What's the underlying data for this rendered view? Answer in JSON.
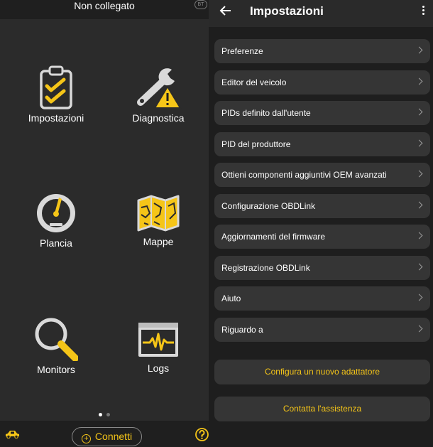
{
  "colors": {
    "accent": "#f5c518",
    "left_bg": "#2b2b2b",
    "right_bg": "#1e1e1e",
    "item_bg": "#353535"
  },
  "left": {
    "status": "Non collegato",
    "bt_badge": "BT",
    "tiles": [
      {
        "label": "Impostazioni",
        "icon": "clipboard-checklist-icon"
      },
      {
        "label": "Diagnostica",
        "icon": "wrench-warning-icon"
      },
      {
        "label": "Plancia",
        "icon": "gauge-icon"
      },
      {
        "label": "Mappe",
        "icon": "map-icon"
      },
      {
        "label": "Monitors",
        "icon": "magnifier-icon"
      },
      {
        "label": "Logs",
        "icon": "waveform-log-icon"
      }
    ],
    "page_indicator": {
      "pages": 2,
      "active": 1
    },
    "bottom": {
      "car_icon": "car-icon",
      "connect_label": "Connetti",
      "help_icon": "help-icon"
    }
  },
  "right": {
    "title": "Impostazioni",
    "back_icon": "arrow-left-icon",
    "menu_icon": "kebab-menu-icon",
    "items": [
      {
        "label": "Preferenze"
      },
      {
        "label": "Editor del veicolo"
      },
      {
        "label": "PIDs definito dall'utente"
      },
      {
        "label": "PID del produttore"
      },
      {
        "label": "Ottieni componenti aggiuntivi OEM avanzati"
      },
      {
        "label": "Configurazione OBDLink"
      },
      {
        "label": "Aggiornamenti del firmware"
      },
      {
        "label": "Registrazione OBDLink"
      },
      {
        "label": "Aiuto"
      },
      {
        "label": "Riguardo a"
      }
    ],
    "actions": [
      {
        "label": "Configura un nuovo adattatore"
      },
      {
        "label": "Contatta l'assistenza"
      }
    ]
  }
}
